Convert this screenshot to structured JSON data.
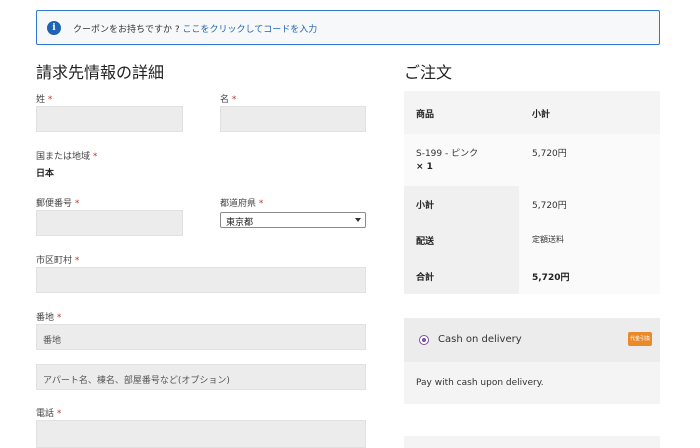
{
  "notice": {
    "message": "クーポンをお持ちですか ? ",
    "link": "ここをクリックしてコードを入力"
  },
  "billing": {
    "heading": "請求先情報の詳細",
    "required_mark": "*",
    "last_name_label": "姓",
    "first_name_label": "名",
    "country_label": "国または地域",
    "country_value": "日本",
    "postcode_label": "郵便番号",
    "prefecture_label": "都道府県",
    "prefecture_value": "東京都",
    "city_label": "市区町村",
    "address1_label": "番地",
    "address1_placeholder": "番地",
    "address2_placeholder": "アパート名、棟名、部屋番号など(オプション)",
    "phone_label": "電話"
  },
  "order": {
    "heading": "ご注文",
    "col_product": "商品",
    "col_subtotal": "小計",
    "item_name": "S-199 - ピンク",
    "item_qty": "× 1",
    "item_total": "5,720円",
    "subtotal_label": "小計",
    "subtotal_value": "5,720円",
    "shipping_label": "配送",
    "shipping_value": "定額送料",
    "total_label": "合計",
    "total_value": "5,720円"
  },
  "payment": {
    "method": "Cash on delivery",
    "badge": "代金引換",
    "description": "Pay with cash upon delivery."
  },
  "colors": {
    "accent": "#1f63b4",
    "required": "#c0392b",
    "radio": "#7b4fa3",
    "badge": "#e98a2a"
  }
}
